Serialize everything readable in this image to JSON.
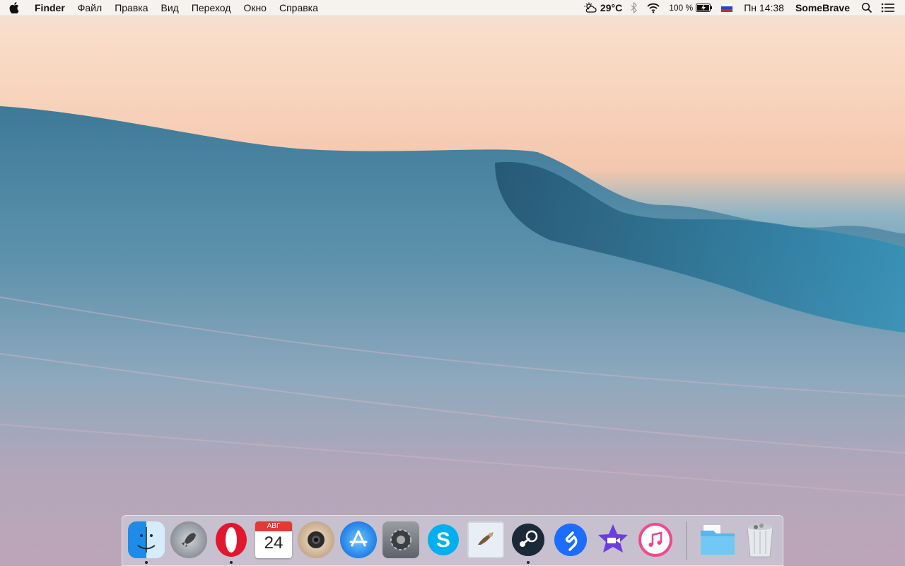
{
  "menubar": {
    "app_name": "Finder",
    "items": [
      "Файл",
      "Правка",
      "Вид",
      "Переход",
      "Окно",
      "Справка"
    ],
    "weather_temp": "29°C",
    "battery": "100 %",
    "clock": "Пн 14:38",
    "user": "SomeBrave"
  },
  "dock": {
    "apps": [
      {
        "name": "Finder",
        "icon": "finder-icon",
        "running": true
      },
      {
        "name": "Launchpad",
        "icon": "launchpad-icon",
        "running": false
      },
      {
        "name": "Opera",
        "icon": "opera-icon",
        "running": true
      },
      {
        "name": "Calendar",
        "icon": "calendar-icon",
        "running": false,
        "month": "АВГ",
        "day": "24"
      },
      {
        "name": "Camera",
        "icon": "camera-icon",
        "running": false
      },
      {
        "name": "App Store",
        "icon": "app-store-icon",
        "running": false
      },
      {
        "name": "System Preferences",
        "icon": "system-preferences-icon",
        "running": false
      },
      {
        "name": "Skype",
        "icon": "skype-icon",
        "running": false
      },
      {
        "name": "Mail",
        "icon": "mail-icon",
        "running": false
      },
      {
        "name": "Steam",
        "icon": "steam-icon",
        "running": true
      },
      {
        "name": "Shazam",
        "icon": "shazam-icon",
        "running": false
      },
      {
        "name": "iMovie",
        "icon": "imovie-icon",
        "running": false
      },
      {
        "name": "iTunes",
        "icon": "itunes-icon",
        "running": false
      }
    ],
    "folders": [
      {
        "name": "Documents",
        "icon": "folder-icon"
      },
      {
        "name": "Trash",
        "icon": "trash-icon"
      }
    ]
  }
}
